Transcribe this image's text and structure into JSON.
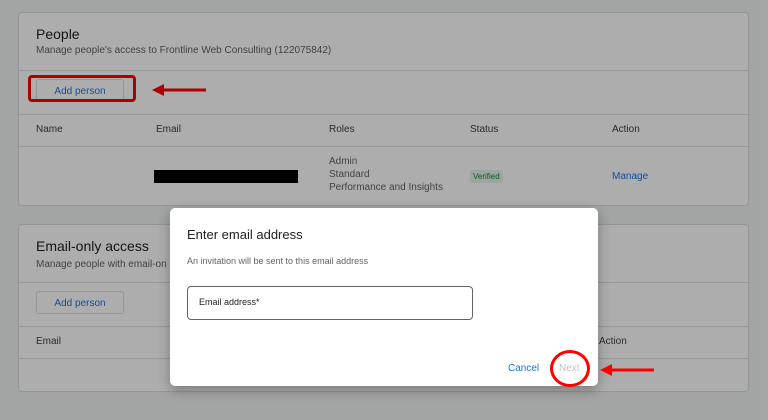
{
  "people": {
    "title": "People",
    "subtitle": "Manage people's access to Frontline Web Consulting (122075842)",
    "add_button": "Add person",
    "columns": [
      "Name",
      "Email",
      "Roles",
      "Status",
      "Action"
    ],
    "row": {
      "roles": [
        "Admin",
        "Standard",
        "Performance and Insights"
      ],
      "status": "Verified",
      "action": "Manage"
    }
  },
  "email_only": {
    "title": "Email-only access",
    "subtitle": "Manage people with email-on",
    "add_button": "Add person",
    "columns": [
      "Email",
      "Action"
    ]
  },
  "dialog": {
    "title": "Enter email address",
    "subtitle": "An invitation will be sent to this email address",
    "input_label": "Email address*",
    "cancel": "Cancel",
    "next": "Next"
  },
  "colors": {
    "accent": "#1a73e8",
    "verified": "#188038",
    "annotation": "#ff0000"
  }
}
